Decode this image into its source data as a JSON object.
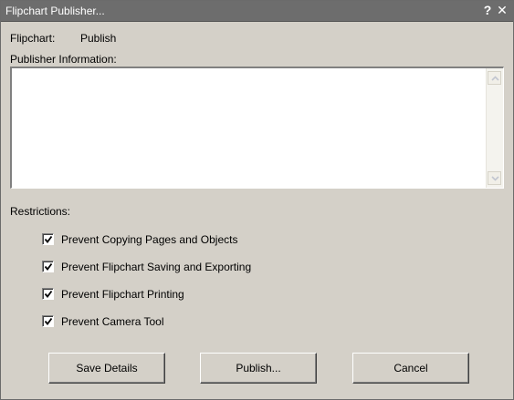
{
  "window": {
    "title": "Flipchart Publisher...",
    "help_glyph": "?",
    "close_glyph": "✕"
  },
  "flipchart": {
    "label": "Flipchart:",
    "value": "Publish"
  },
  "publisher_info": {
    "label": "Publisher Information:",
    "value": ""
  },
  "restrictions": {
    "label": "Restrictions:",
    "items": [
      {
        "label": "Prevent Copying Pages and Objects",
        "checked": true
      },
      {
        "label": "Prevent Flipchart Saving and Exporting",
        "checked": true
      },
      {
        "label": "Prevent Flipchart Printing",
        "checked": true
      },
      {
        "label": "Prevent Camera Tool",
        "checked": true
      }
    ]
  },
  "buttons": {
    "save": "Save Details",
    "publish": "Publish...",
    "cancel": "Cancel"
  }
}
